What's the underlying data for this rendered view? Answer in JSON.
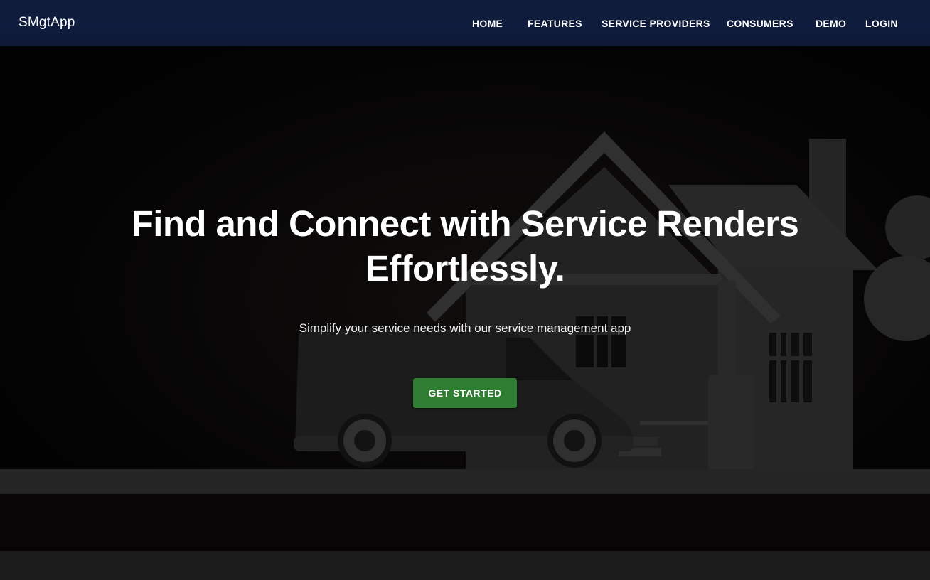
{
  "brand": {
    "name": "SMgtApp"
  },
  "nav": {
    "home": "HOME",
    "features": "FEATURES",
    "service_providers": "SERVICE PROVIDERS",
    "consumers": "CONSUMERS",
    "demo": "DEMO",
    "login": "LOGIN"
  },
  "hero": {
    "title_line1": "Find and Connect with Service Renders",
    "title_line2": "Effortlessly.",
    "subtitle": "Simplify your service needs with our service management app",
    "cta_label": "GET STARTED"
  },
  "colors": {
    "navbar": "#101c3d",
    "cta": "#2e7d32",
    "hero_bg": "#050505"
  }
}
